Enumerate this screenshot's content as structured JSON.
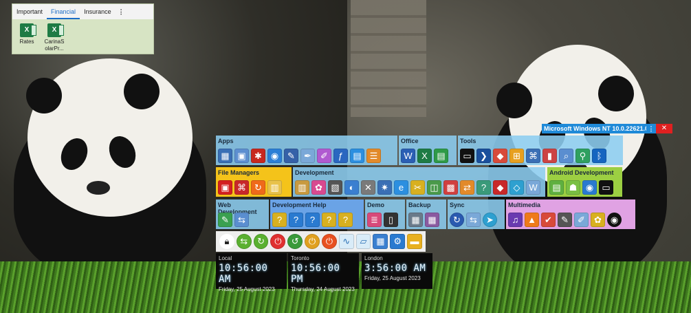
{
  "tabs_widget": {
    "tabs": [
      "Important",
      "Financial",
      "Insurance"
    ],
    "active_tab": "Financial",
    "more": "⋮",
    "files": [
      {
        "label": "Rates",
        "icon": "excel-icon"
      },
      {
        "label": "CarinaS olarPr...",
        "icon": "excel-icon"
      }
    ]
  },
  "groups": {
    "apps": {
      "title": "Apps"
    },
    "office": {
      "title": "Office"
    },
    "tools": {
      "title": "Tools"
    },
    "file_managers": {
      "title": "File Managers"
    },
    "development": {
      "title": "Development"
    },
    "android": {
      "title": "Android Development"
    },
    "web_dev": {
      "title": "Web Development"
    },
    "dev_help": {
      "title": "Development Help"
    },
    "demo": {
      "title": "Demo"
    },
    "backup": {
      "title": "Backup"
    },
    "sync": {
      "title": "Sync"
    },
    "multimedia": {
      "title": "Multimedia"
    }
  },
  "window_title_bar": {
    "title": "Microsoft Windows NT 10.0.22621.0",
    "more": "⋮",
    "close": "✕"
  },
  "clocks": [
    {
      "city": "Local",
      "time": "10:56:00 AM",
      "date": "Friday, 25 August 2023"
    },
    {
      "city": "Toronto",
      "time": "10:56:00 PM",
      "date": "Thursday, 24 August 2023"
    },
    {
      "city": "London",
      "time": "3:56:00 AM",
      "date": "Friday, 25 August 2023"
    }
  ],
  "colors": {
    "accent_blue": "#1f8ad8",
    "close_red": "#e02020",
    "file_managers": "#f4c31a",
    "android": "#9ccf42",
    "multimedia": "#e0a2e3"
  }
}
